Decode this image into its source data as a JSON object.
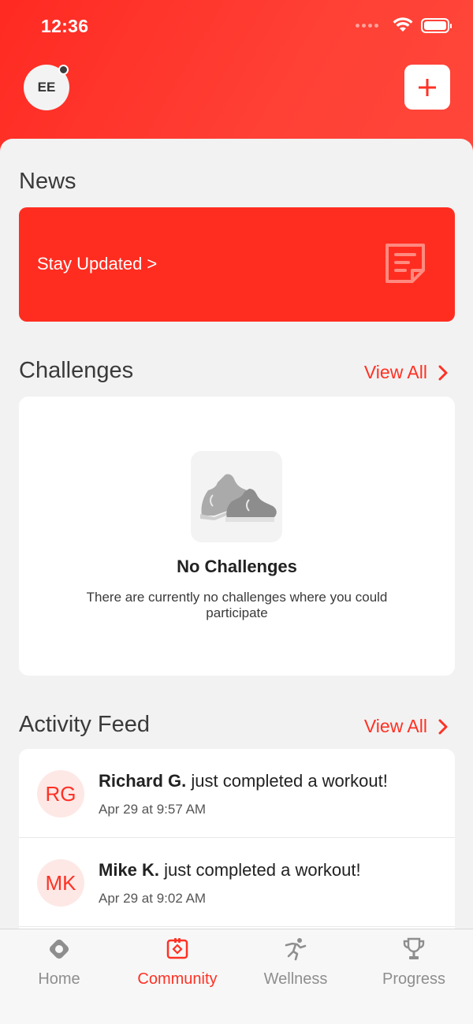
{
  "status": {
    "time": "12:36"
  },
  "header": {
    "avatar_initials": "EE"
  },
  "news": {
    "title": "News",
    "card_label": "Stay Updated >"
  },
  "challenges": {
    "title": "Challenges",
    "view_all": "View All",
    "empty_title": "No Challenges",
    "empty_desc": "There are currently no challenges where you could participate"
  },
  "activity": {
    "title": "Activity Feed",
    "view_all": "View All",
    "items": [
      {
        "initials": "RG",
        "name": "Richard G.",
        "text": " just completed a workout!",
        "time": "Apr 29 at 9:57 AM"
      },
      {
        "initials": "MK",
        "name": "Mike K.",
        "text": " just completed a workout!",
        "time": "Apr 29 at 9:02 AM"
      }
    ]
  },
  "tabs": [
    {
      "label": "Home",
      "icon": "home-icon",
      "active": false
    },
    {
      "label": "Community",
      "icon": "community-icon",
      "active": true
    },
    {
      "label": "Wellness",
      "icon": "wellness-icon",
      "active": false
    },
    {
      "label": "Progress",
      "icon": "trophy-icon",
      "active": false
    }
  ],
  "colors": {
    "accent": "#ff3124",
    "inactive": "#8e8e8e"
  }
}
